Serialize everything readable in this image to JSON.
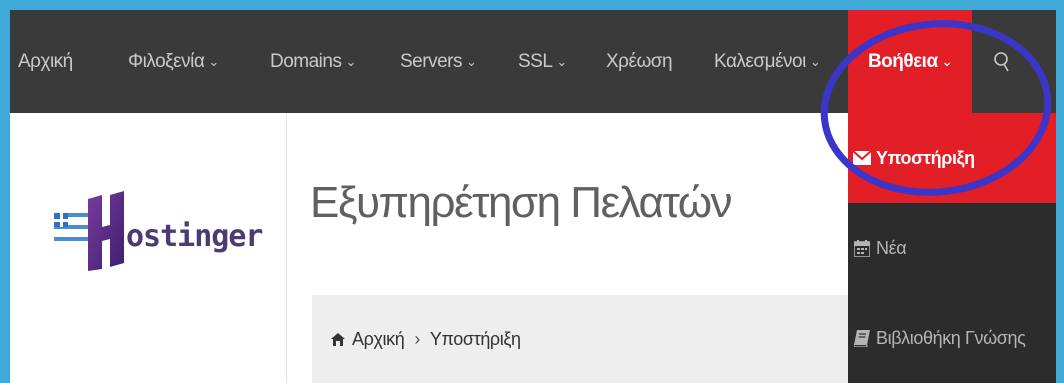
{
  "nav": {
    "items": [
      {
        "label": "Αρχική",
        "dropdown": false
      },
      {
        "label": "Φιλοξενία",
        "dropdown": true
      },
      {
        "label": "Domains",
        "dropdown": true
      },
      {
        "label": "Servers",
        "dropdown": true
      },
      {
        "label": "SSL",
        "dropdown": true
      },
      {
        "label": "Χρέωση",
        "dropdown": false
      },
      {
        "label": "Καλεσμένοι",
        "dropdown": true
      }
    ],
    "help_label": "Βοήθεια",
    "chevron": "⌄"
  },
  "logo": {
    "text": "ostinger",
    "letter": "H"
  },
  "page": {
    "title": "Εξυπηρέτηση Πελατών"
  },
  "breadcrumb": {
    "home": "Αρχική",
    "separator": "›",
    "current": "Υποστήριξη"
  },
  "dropdown": {
    "items": [
      {
        "label": "Υποστήριξη",
        "icon": "envelope-icon",
        "active": true
      },
      {
        "label": "Νέα",
        "icon": "calendar-icon",
        "active": false
      },
      {
        "label": "Βιβλιοθήκη Γνώσης",
        "icon": "book-icon",
        "active": false
      }
    ]
  },
  "colors": {
    "navbar": "#3a3a3a",
    "accent": "#e21e26",
    "dropdown": "#2c2c2c",
    "highlight": "#3b35c9",
    "frame": "#3fa9d8"
  }
}
